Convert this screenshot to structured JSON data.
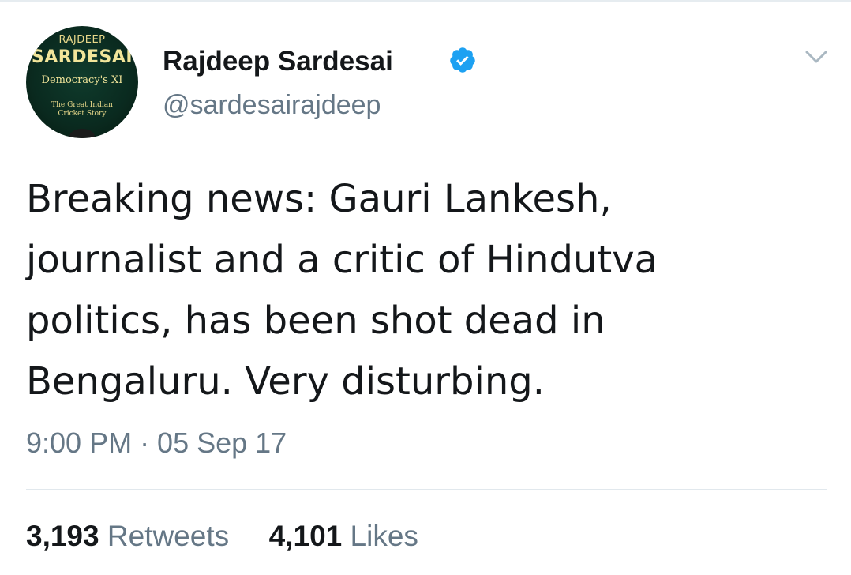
{
  "author": {
    "display_name": "Rajdeep Sardesai",
    "handle": "@sardesairajdeep",
    "verified": true,
    "avatar": {
      "line1": "RAJDEEP",
      "line2": "SARDESAI",
      "line3": "Democracy's XI",
      "line4a": "The Great Indian",
      "line4b": "Cricket Story"
    }
  },
  "tweet": {
    "lines": [
      "Breaking news: Gauri Lankesh,",
      "journalist and a critic of Hindutva",
      "politics, has been shot dead in",
      "Bengaluru. Very disturbing."
    ],
    "timestamp": "9:00 PM · 05 Sep 17"
  },
  "stats": {
    "retweets_count": "3,193",
    "retweets_label": "Retweets",
    "likes_count": "4,101",
    "likes_label": "Likes"
  },
  "icons": {
    "verified": "verified-badge-icon",
    "menu": "chevron-down-icon"
  },
  "colors": {
    "verified_blue": "#1da1f2",
    "secondary_text": "#657786",
    "primary_text": "#14171a"
  }
}
